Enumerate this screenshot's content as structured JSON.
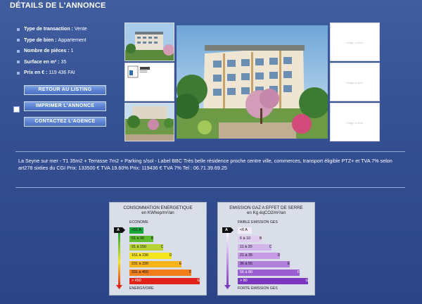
{
  "header": {
    "title": "DÉTAILS DE L'ANNONCE"
  },
  "properties": [
    {
      "label": "Type de transaction :",
      "value": "Vente"
    },
    {
      "label": "Type de bien :",
      "value": "Appartement"
    },
    {
      "label": "Nombre de pièces :",
      "value": "1"
    },
    {
      "label": "Surface en m² :",
      "value": "35"
    },
    {
      "label": "Prix en € :",
      "value": "119 436 FAI"
    }
  ],
  "buttons": {
    "retour": "RETOUR AU LISTING",
    "imprimer": "IMPRIMER L'ANNONCE",
    "contactez": "CONTACTEZ L'AGENCE"
  },
  "gallery": {
    "placeholder_text": "Image à venir"
  },
  "description": "La Seyne sur mer - T1 35m2 + Terrasse 7m2 + Parking s/sol - Label BBC Très belle résidence proche centre ville, commerces, transport éligible PTZ+ et TVA 7% selon art278 sixties du CGI Prix: 133500 € TVA 19.60% Prix: 119436 € TVA 7% Tel : 06.71.39.69.25",
  "energy": {
    "title_line1": "CONSOMMATION ENERGETIQUE",
    "title_line2": "en KWhep/m²/an",
    "top": "ECONOME",
    "bottom": "ENERGIVORE",
    "current": "A",
    "classes": [
      {
        "range": "<51 A",
        "letter": "",
        "color": "#13a538"
      },
      {
        "range": "51 à 90",
        "letter": "B",
        "color": "#5dbb2d"
      },
      {
        "range": "91 à 150",
        "letter": "C",
        "color": "#b7d334"
      },
      {
        "range": "151 à 230",
        "letter": "D",
        "color": "#f4e41b"
      },
      {
        "range": "231 à 330",
        "letter": "E",
        "color": "#f7b418"
      },
      {
        "range": "331 à 450",
        "letter": "F",
        "color": "#ef7d1a"
      },
      {
        "range": "> 450",
        "letter": "G",
        "color": "#e2231a"
      }
    ]
  },
  "ges": {
    "title_line1": "EMISSION GAZ A EFFET DE SERRE",
    "title_line2": "en Kg éqCO2/m²/an",
    "top": "FAIBLE EMISSION GES",
    "bottom": "FORTE EMISSION GES",
    "current": "A",
    "classes": [
      {
        "range": "<6 A",
        "letter": "",
        "color": "#f3ecf8"
      },
      {
        "range": "6 à 10",
        "letter": "B",
        "color": "#e1cdef"
      },
      {
        "range": "11 à 20",
        "letter": "C",
        "color": "#d2b5ea"
      },
      {
        "range": "21 à 35",
        "letter": "D",
        "color": "#c49be4"
      },
      {
        "range": "36 à 55",
        "letter": "E",
        "color": "#b07fdb"
      },
      {
        "range": "56 à 80",
        "letter": "F",
        "color": "#9a5ed1"
      },
      {
        "range": "> 80",
        "letter": "G",
        "color": "#7c37c1"
      }
    ]
  }
}
